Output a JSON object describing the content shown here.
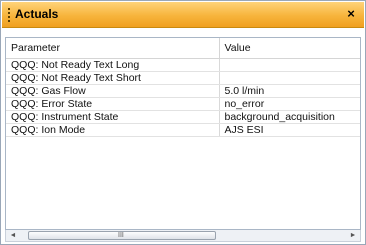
{
  "panel": {
    "title": "Actuals",
    "close_glyph": "×"
  },
  "table": {
    "columns": [
      "Parameter",
      "Value"
    ],
    "rows": [
      {
        "parameter": "QQQ: Not Ready Text Long",
        "value": ""
      },
      {
        "parameter": "QQQ: Not Ready Text Short",
        "value": ""
      },
      {
        "parameter": "QQQ: Gas Flow",
        "value": "5.0 l/min"
      },
      {
        "parameter": "QQQ: Error State",
        "value": "no_error"
      },
      {
        "parameter": "QQQ: Instrument State",
        "value": "background_acquisition"
      },
      {
        "parameter": "QQQ: Ion Mode",
        "value": "AJS ESI"
      }
    ]
  },
  "scrollbar": {
    "left_arrow": "◄",
    "right_arrow": "►",
    "thumb_grip": "III"
  },
  "icons": {
    "grip": "drag-grip-icon",
    "close": "close-icon",
    "left": "scroll-left-icon",
    "right": "scroll-right-icon"
  }
}
